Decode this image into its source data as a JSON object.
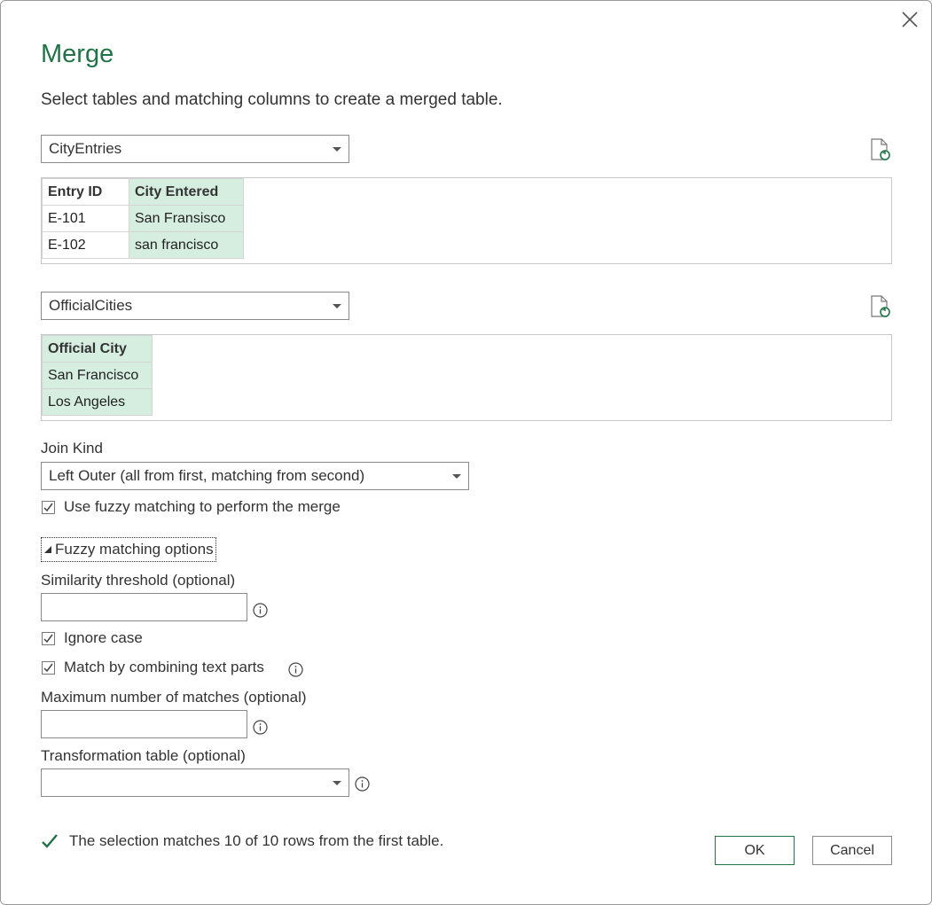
{
  "dialog": {
    "title": "Merge",
    "subtitle": "Select tables and matching columns to create a merged table."
  },
  "first_table": {
    "selected": "CityEntries",
    "columns": [
      "Entry ID",
      "City Entered"
    ],
    "rows": [
      [
        "E-101",
        "San Fransisco"
      ],
      [
        "E-102",
        "san francisco"
      ]
    ]
  },
  "second_table": {
    "selected": "OfficialCities",
    "columns": [
      "Official City"
    ],
    "rows": [
      [
        "San Francisco"
      ],
      [
        "Los Angeles"
      ]
    ]
  },
  "join_kind": {
    "label": "Join Kind",
    "selected": "Left Outer (all from first, matching from second)"
  },
  "fuzzy": {
    "use_label": "Use fuzzy matching to perform the merge",
    "options_label": "Fuzzy matching options",
    "similarity_label": "Similarity threshold (optional)",
    "similarity_value": "",
    "ignore_case_label": "Ignore case",
    "combine_label": "Match by combining text parts",
    "max_matches_label": "Maximum number of matches (optional)",
    "max_matches_value": "",
    "transformation_label": "Transformation table (optional)",
    "transformation_value": ""
  },
  "status": {
    "message": "The selection matches 10 of 10 rows from the first table."
  },
  "buttons": {
    "ok": "OK",
    "cancel": "Cancel"
  },
  "colors": {
    "accent": "#217346",
    "selected_column": "#d5eee0"
  }
}
